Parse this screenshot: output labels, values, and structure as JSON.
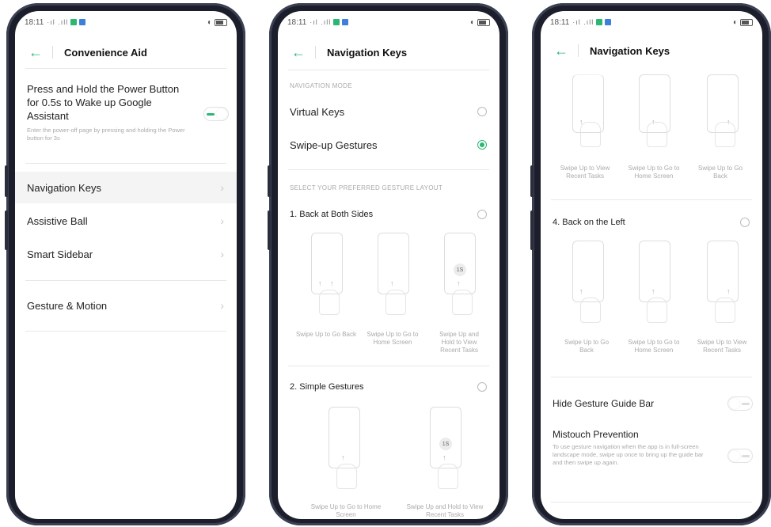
{
  "status": {
    "time": "18:11",
    "signal": "·ıl .ıll",
    "dots": "· ···",
    "right": "◖◯"
  },
  "colors": {
    "accent": "#2bb673"
  },
  "screen1": {
    "title": "Convenience Aid",
    "power_title": "Press and Hold the Power Button for 0.5s to Wake up Google Assistant",
    "power_desc": "Enter the power-off page by pressing and holding the Power button for 3s",
    "power_toggle_on": true,
    "items": [
      {
        "label": "Navigation Keys"
      },
      {
        "label": "Assistive Ball"
      },
      {
        "label": "Smart Sidebar"
      },
      {
        "label": "Gesture & Motion"
      }
    ]
  },
  "screen2": {
    "title": "Navigation Keys",
    "section_mode": "NAVIGATION MODE",
    "mode_virtual": "Virtual Keys",
    "mode_swipe": "Swipe-up Gestures",
    "section_layout": "SELECT YOUR PREFERRED GESTURE LAYOUT",
    "layout1": "1. Back at Both Sides",
    "layout1_caps": [
      "Swipe Up to Go Back",
      "Swipe Up to Go to Home Screen",
      "Swipe Up and Hold to View Recent Tasks"
    ],
    "badge": "1S",
    "layout2": "2. Simple Gestures",
    "layout2_caps": [
      "Swipe Up to Go to Home Screen",
      "Swipe Up and Hold to View Recent Tasks"
    ]
  },
  "screen3": {
    "title": "Navigation Keys",
    "top_caps": [
      "Swipe Up to View Recent Tasks",
      "Swipe Up to Go to Home Screen",
      "Swipe Up to Go Back"
    ],
    "layout4": "4. Back on the Left",
    "layout4_caps": [
      "Swipe Up to Go Back",
      "Swipe Up to Go to Home Screen",
      "Swipe Up to View Recent Tasks"
    ],
    "hide_bar": "Hide Gesture Guide Bar",
    "mistouch": "Mistouch Prevention",
    "mistouch_desc": "To use gesture navigation when the app is in full-screen landscape mode, swipe up once to bring up the guide bar and then swipe up again."
  }
}
